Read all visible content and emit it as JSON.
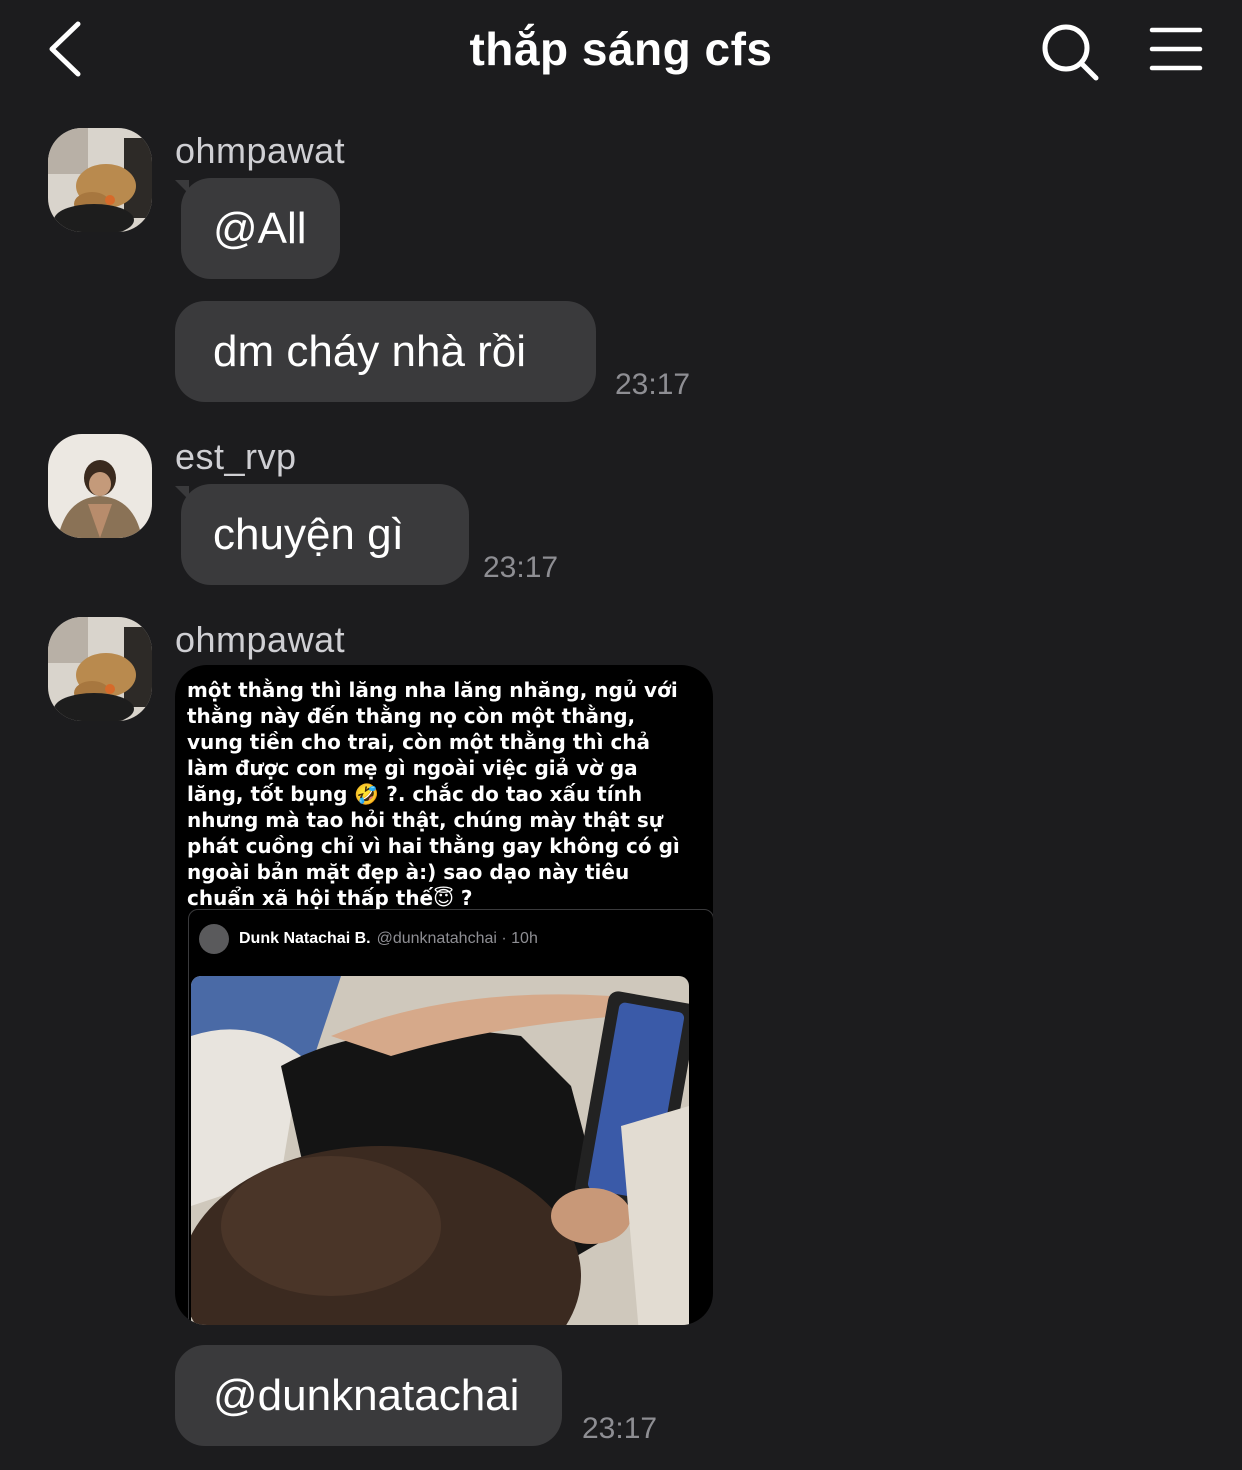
{
  "header": {
    "title": "thắp sáng cfs"
  },
  "messages": [
    {
      "user": "ohmpawat",
      "bubbles": [
        "@All",
        "dm cháy nhà rồi"
      ],
      "time": "23:17"
    },
    {
      "user": "est_rvp",
      "bubbles": [
        "chuyện gì"
      ],
      "time": "23:17"
    },
    {
      "user": "ohmpawat",
      "screenshot": {
        "caption": "một thằng thì lăng nha lăng nhăng, ngủ với thằng này đến thằng nọ còn một thằng, vung tiền cho trai, còn một thằng thì chả làm được con mẹ gì ngoài việc giả vờ ga lăng, tốt bụng 🤣 ?. chắc do tao xấu tính nhưng mà tao hỏi thật, chúng mày thật sự phát cuồng chỉ vì hai thằng gay không có gì ngoài bản mặt đẹp à:) sao dạo này tiêu chuẩn xã hội thấp thế😇 ?",
        "quote": {
          "name": "Dunk Natachai B.",
          "handle": "@dunknatahchai · 10h"
        }
      },
      "bubbles": [
        "@dunknatachai"
      ],
      "time": "23:17"
    }
  ],
  "colors": {
    "background": "#1c1c1e",
    "bubble": "#3a3a3c",
    "timestamp": "#8e8e93",
    "username": "#cfcfd3"
  },
  "icons": {
    "back": "chevron-left-icon",
    "search": "search-icon",
    "menu": "hamburger-menu-icon"
  }
}
